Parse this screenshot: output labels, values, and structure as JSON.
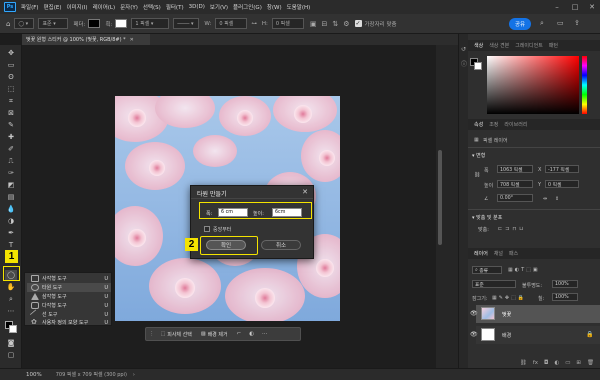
{
  "app": {
    "logo": "Ps"
  },
  "menubar": {
    "items": [
      "파일(F)",
      "편집(E)",
      "이미지(I)",
      "레이어(L)",
      "문자(Y)",
      "선택(S)",
      "필터(T)",
      "3D(D)",
      "보기(V)",
      "플러그인(G)",
      "창(W)",
      "도움말(H)"
    ]
  },
  "options": {
    "style_value": "표준",
    "feather_label": "페더:",
    "feather_value": "0 픽셀",
    "width_value": "1 픽셀",
    "w_label": "W:",
    "w_value": "0 픽셀",
    "h_label": "H:",
    "h_value": "0 픽셀",
    "align_label": "가장자리 맞춤",
    "share": "공유"
  },
  "doc_tab": {
    "title": "벚꽃 원형 스티커 @ 100% (벚꽃, RGB/8#) *"
  },
  "flyout": {
    "items": [
      "사각형 도구",
      "타원 도구",
      "삼각형 도구",
      "다각형 도구",
      "선 도구",
      "사용자 정의 모양 도구"
    ],
    "shortcut": "U"
  },
  "dialog": {
    "title": "타원 만들기",
    "width_label": "폭:",
    "width_value": "6 cm",
    "height_label": "높이:",
    "height_value": "6cm",
    "center_label": "중앙부터",
    "ok": "확인",
    "cancel": "취소"
  },
  "badges": {
    "step1": "1",
    "step2": "2"
  },
  "context_bar": {
    "select_subject": "피사체 선택",
    "remove_bg": "배경 제거"
  },
  "panels": {
    "color_tabs": [
      "색상",
      "색상 견본",
      "그레이디언트",
      "패턴"
    ],
    "props_tabs": [
      "속성",
      "조정",
      "라이브러리"
    ],
    "pixel_layer": "픽셀 레이어",
    "transform": "변형",
    "w_label": "폭",
    "w_value": "1063 픽셀",
    "x_label": "X",
    "x_value": "-177 픽셀",
    "h_label": "높이",
    "h_value": "708 픽셀",
    "y_label": "Y",
    "y_value": "0 픽셀",
    "angle_value": "0.00°",
    "align_title": "맞춤 및 분포",
    "align_label": "맞춤:",
    "layers_tabs": [
      "레이어",
      "채널",
      "패스"
    ],
    "kind_label": "종류",
    "blend_mode": "표준",
    "opacity_label": "불투명도:",
    "opacity_value": "100%",
    "lock_label": "잠그기:",
    "fill_label": "칠:",
    "fill_value": "100%",
    "layers": [
      "벚꽃",
      "배경"
    ]
  },
  "status": {
    "zoom": "100%",
    "doc_info": "709 픽셀 x 709 픽셀 (300 ppi)"
  },
  "colors": {
    "highlight": "#f4e300",
    "accent": "#1473e6"
  }
}
